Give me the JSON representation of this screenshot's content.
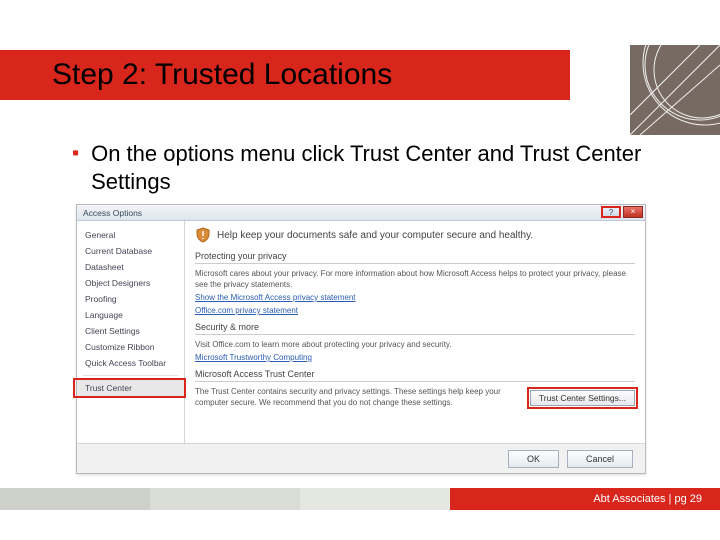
{
  "header": {
    "title": "Step 2: Trusted Locations"
  },
  "bullet": {
    "text": "On the options menu click Trust Center and Trust Center Settings"
  },
  "dialog": {
    "window_title": "Access Options",
    "win_buttons": {
      "help": "?",
      "close": "×"
    },
    "sidebar": {
      "items": [
        "General",
        "Current Database",
        "Datasheet",
        "Object Designers",
        "Proofing",
        "Language",
        "Client Settings",
        "Customize Ribbon",
        "Quick Access Toolbar"
      ],
      "trust": "Trust Center"
    },
    "main": {
      "banner": "Help keep your documents safe and your computer secure and healthy.",
      "sections": {
        "privacy": {
          "title": "Protecting your privacy",
          "body": "Microsoft cares about your privacy. For more information about how Microsoft Access helps to protect your privacy, please see the privacy statements.",
          "link1": "Show the Microsoft Access privacy statement",
          "link2": "Office.com privacy statement"
        },
        "security": {
          "title": "Security & more",
          "body": "Visit Office.com to learn more about protecting your privacy and security.",
          "link": "Microsoft Trustworthy Computing"
        },
        "trustcenter": {
          "title": "Microsoft Access Trust Center",
          "body": "The Trust Center contains security and privacy settings. These settings help keep your computer secure. We recommend that you do not change these settings.",
          "button": "Trust Center Settings..."
        }
      }
    },
    "footer": {
      "ok": "OK",
      "cancel": "Cancel"
    }
  },
  "footer": {
    "text": "Abt Associates | pg 29"
  }
}
